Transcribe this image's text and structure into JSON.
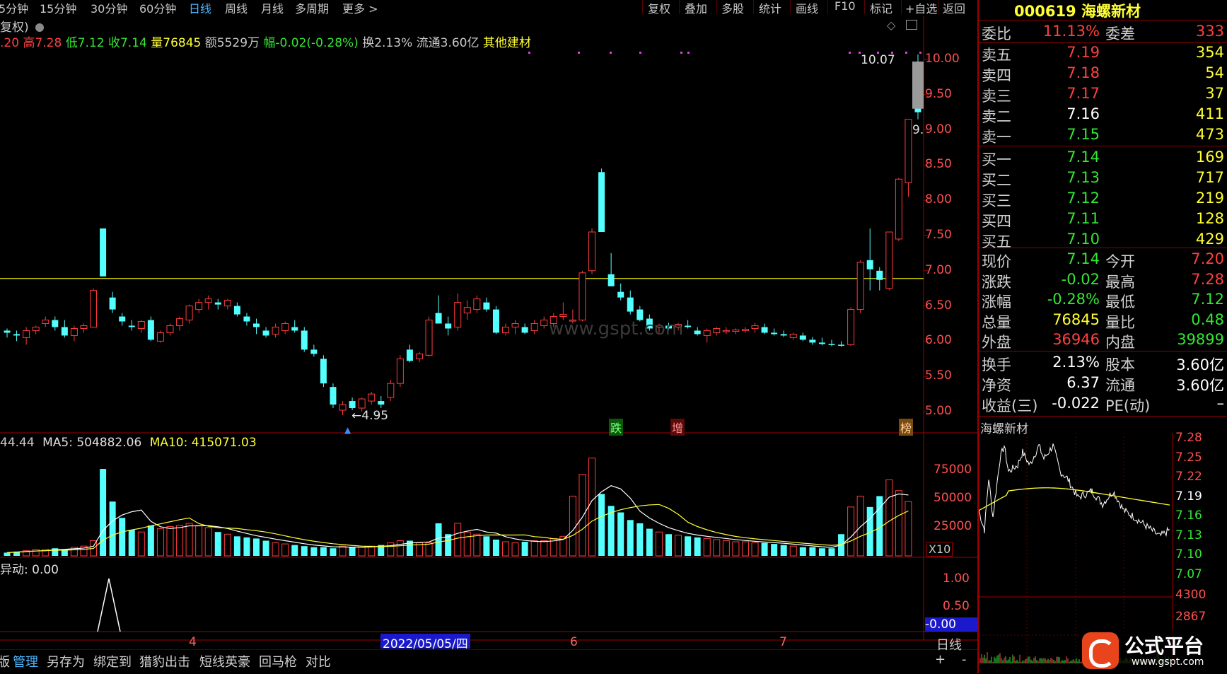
{
  "topbar": {
    "periods": [
      "5分钟",
      "15分钟",
      "30分钟",
      "60分钟",
      "日线",
      "周线",
      "月线",
      "多周期",
      "更多 >"
    ],
    "active_period": "日线",
    "buttons": [
      "复权",
      "叠加",
      "多股",
      "统计",
      "画线",
      "F10",
      "标记",
      "+自选",
      "返回"
    ]
  },
  "stock": {
    "code": "000619",
    "name": "海螺新材"
  },
  "info": {
    "fuquan": "复权)",
    "open": ".20",
    "high": "高7.28",
    "low": "低7.12",
    "close": "收7.14",
    "volume": "量76845",
    "amount": "额5529万",
    "change": "幅-0.02(-0.28%)",
    "turnover": "换2.13%",
    "float": "流通3.60亿",
    "sector": "其他建材"
  },
  "price_axis": [
    "10.00",
    "9.50",
    "9.00",
    "8.50",
    "8.00",
    "7.50",
    "7.00",
    "6.50",
    "6.00",
    "5.50",
    "5.00"
  ],
  "annotations": {
    "high_price": "10.07",
    "low_price": "4.95",
    "nine": "9.",
    "tag_die": "跌",
    "tag_zeng": "增",
    "tag_bang": "榜",
    "watermark": "www.gspt.com"
  },
  "volume_panel": {
    "legend_prefix": "44.44",
    "ma5": "MA5: 504882.06",
    "ma10": "MA10: 415071.03",
    "axis": [
      "75000",
      "50000",
      "25000"
    ],
    "unit": "X10"
  },
  "indicator_panel": {
    "label": "异动: 0.00",
    "axis": [
      "1.00",
      "0.50"
    ],
    "current": "-0.00"
  },
  "date_axis": {
    "labels": [
      "4",
      "6",
      "7"
    ],
    "cursor_date": "2022/05/05/四"
  },
  "bottom_bar": {
    "buttons": [
      "版",
      "管理",
      "另存为",
      "绑定到",
      "猎豹出击",
      "短线英豪",
      "回马枪",
      "对比"
    ],
    "active": "管理",
    "right_label": "日线",
    "plus": "+",
    "minus": "-"
  },
  "order_book": {
    "weibi_label": "委比",
    "weibi_value": "11.13%",
    "weicha_label": "委差",
    "weicha_value": "333",
    "asks": [
      {
        "label": "卖五",
        "price": "7.19",
        "volume": "354"
      },
      {
        "label": "卖四",
        "price": "7.18",
        "volume": "54"
      },
      {
        "label": "卖三",
        "price": "7.17",
        "volume": "37"
      },
      {
        "label": "卖二",
        "price": "7.16",
        "volume": "411"
      },
      {
        "label": "卖一",
        "price": "7.15",
        "volume": "473"
      }
    ],
    "bids": [
      {
        "label": "买一",
        "price": "7.14",
        "volume": "169"
      },
      {
        "label": "买二",
        "price": "7.13",
        "volume": "717"
      },
      {
        "label": "买三",
        "price": "7.12",
        "volume": "219"
      },
      {
        "label": "买四",
        "price": "7.11",
        "volume": "128"
      },
      {
        "label": "买五",
        "price": "7.10",
        "volume": "429"
      }
    ]
  },
  "quote": [
    {
      "l1": "现价",
      "v1": "7.14",
      "l2": "今开",
      "v2": "7.20"
    },
    {
      "l1": "涨跌",
      "v1": "-0.02",
      "l2": "最高",
      "v2": "7.28"
    },
    {
      "l1": "涨幅",
      "v1": "-0.28%",
      "l2": "最低",
      "v2": "7.12"
    },
    {
      "l1": "总量",
      "v1": "76845",
      "l2": "量比",
      "v2": "0.48"
    },
    {
      "l1": "外盘",
      "v1": "36946",
      "l2": "内盘",
      "v2": "39899"
    }
  ],
  "quote2": [
    {
      "l1": "换手",
      "v1": "2.13%",
      "l2": "股本",
      "v2": "3.60亿"
    },
    {
      "l1": "净资",
      "v1": "6.37",
      "l2": "流通",
      "v2": "3.60亿"
    },
    {
      "l1": "收益(三)",
      "v1": "-0.022",
      "l2": "PE(动)",
      "v2": "–"
    }
  ],
  "mini_chart": {
    "title": "海螺新材",
    "price_axis": [
      "7.28",
      "7.25",
      "7.22",
      "7.19",
      "7.16",
      "7.13",
      "7.10",
      "7.07"
    ],
    "vol_axis": [
      "4300",
      "2867"
    ]
  },
  "logo": {
    "text": "公式平台",
    "url": "www.gspt.com"
  },
  "chart_data": {
    "type": "candlestick",
    "price_ylim": [
      4.9,
      10.1
    ],
    "reference_line": 6.89,
    "candles": [
      {
        "o": 6.15,
        "h": 6.18,
        "l": 6.05,
        "c": 6.12
      },
      {
        "o": 6.1,
        "h": 6.15,
        "l": 6.0,
        "c": 6.08
      },
      {
        "o": 6.05,
        "h": 6.2,
        "l": 5.95,
        "c": 6.15
      },
      {
        "o": 6.15,
        "h": 6.22,
        "l": 6.1,
        "c": 6.2
      },
      {
        "o": 6.25,
        "h": 6.35,
        "l": 6.2,
        "c": 6.3
      },
      {
        "o": 6.3,
        "h": 6.35,
        "l": 6.15,
        "c": 6.2
      },
      {
        "o": 6.2,
        "h": 6.3,
        "l": 6.05,
        "c": 6.08
      },
      {
        "o": 6.08,
        "h": 6.22,
        "l": 6.0,
        "c": 6.18
      },
      {
        "o": 6.18,
        "h": 6.25,
        "l": 6.12,
        "c": 6.22
      },
      {
        "o": 6.2,
        "h": 6.75,
        "l": 6.2,
        "c": 6.72
      },
      {
        "o": 7.6,
        "h": 7.6,
        "l": 6.92,
        "c": 6.92
      },
      {
        "o": 6.62,
        "h": 6.7,
        "l": 6.4,
        "c": 6.45
      },
      {
        "o": 6.35,
        "h": 6.4,
        "l": 6.22,
        "c": 6.28
      },
      {
        "o": 6.22,
        "h": 6.3,
        "l": 6.15,
        "c": 6.2
      },
      {
        "o": 6.18,
        "h": 6.3,
        "l": 6.12,
        "c": 6.28
      },
      {
        "o": 6.3,
        "h": 6.35,
        "l": 6.0,
        "c": 6.02
      },
      {
        "o": 6.0,
        "h": 6.15,
        "l": 5.98,
        "c": 6.12
      },
      {
        "o": 6.12,
        "h": 6.25,
        "l": 6.08,
        "c": 6.22
      },
      {
        "o": 6.22,
        "h": 6.35,
        "l": 6.15,
        "c": 6.32
      },
      {
        "o": 6.3,
        "h": 6.52,
        "l": 6.25,
        "c": 6.5
      },
      {
        "o": 6.45,
        "h": 6.6,
        "l": 6.4,
        "c": 6.55
      },
      {
        "o": 6.55,
        "h": 6.65,
        "l": 6.45,
        "c": 6.6
      },
      {
        "o": 6.55,
        "h": 6.6,
        "l": 6.45,
        "c": 6.52
      },
      {
        "o": 6.5,
        "h": 6.6,
        "l": 6.45,
        "c": 6.58
      },
      {
        "o": 6.5,
        "h": 6.55,
        "l": 6.35,
        "c": 6.38
      },
      {
        "o": 6.35,
        "h": 6.4,
        "l": 6.22,
        "c": 6.28
      },
      {
        "o": 6.25,
        "h": 6.32,
        "l": 6.1,
        "c": 6.2
      },
      {
        "o": 6.15,
        "h": 6.2,
        "l": 6.05,
        "c": 6.08
      },
      {
        "o": 6.1,
        "h": 6.25,
        "l": 6.05,
        "c": 6.2
      },
      {
        "o": 6.15,
        "h": 6.28,
        "l": 6.1,
        "c": 6.25
      },
      {
        "o": 6.2,
        "h": 6.3,
        "l": 6.12,
        "c": 6.15
      },
      {
        "o": 6.15,
        "h": 6.2,
        "l": 5.85,
        "c": 5.88
      },
      {
        "o": 5.88,
        "h": 5.95,
        "l": 5.78,
        "c": 5.82
      },
      {
        "o": 5.75,
        "h": 5.8,
        "l": 5.35,
        "c": 5.4
      },
      {
        "o": 5.35,
        "h": 5.4,
        "l": 5.05,
        "c": 5.1
      },
      {
        "o": 5.02,
        "h": 5.15,
        "l": 4.95,
        "c": 5.1
      },
      {
        "o": 5.15,
        "h": 5.2,
        "l": 5.02,
        "c": 5.05
      },
      {
        "o": 5.05,
        "h": 5.2,
        "l": 5.0,
        "c": 5.18
      },
      {
        "o": 5.15,
        "h": 5.28,
        "l": 5.1,
        "c": 5.25
      },
      {
        "o": 5.15,
        "h": 5.22,
        "l": 5.05,
        "c": 5.1
      },
      {
        "o": 5.2,
        "h": 5.45,
        "l": 5.15,
        "c": 5.4
      },
      {
        "o": 5.4,
        "h": 5.8,
        "l": 5.35,
        "c": 5.75
      },
      {
        "o": 5.88,
        "h": 5.95,
        "l": 5.7,
        "c": 5.72
      },
      {
        "o": 5.75,
        "h": 5.85,
        "l": 5.7,
        "c": 5.82
      },
      {
        "o": 5.8,
        "h": 6.35,
        "l": 5.78,
        "c": 6.3
      },
      {
        "o": 6.4,
        "h": 6.65,
        "l": 6.25,
        "c": 6.25
      },
      {
        "o": 6.25,
        "h": 6.35,
        "l": 6.08,
        "c": 6.18
      },
      {
        "o": 6.2,
        "h": 6.68,
        "l": 6.15,
        "c": 6.55
      },
      {
        "o": 6.4,
        "h": 6.58,
        "l": 6.3,
        "c": 6.48
      },
      {
        "o": 6.45,
        "h": 6.65,
        "l": 6.4,
        "c": 6.6
      },
      {
        "o": 6.55,
        "h": 6.62,
        "l": 6.42,
        "c": 6.45
      },
      {
        "o": 6.45,
        "h": 6.5,
        "l": 6.1,
        "c": 6.12
      },
      {
        "o": 6.12,
        "h": 6.25,
        "l": 6.08,
        "c": 6.2
      },
      {
        "o": 6.2,
        "h": 6.3,
        "l": 6.1,
        "c": 6.25
      },
      {
        "o": 6.2,
        "h": 6.25,
        "l": 6.1,
        "c": 6.12
      },
      {
        "o": 6.15,
        "h": 6.3,
        "l": 6.1,
        "c": 6.25
      },
      {
        "o": 6.22,
        "h": 6.35,
        "l": 6.18,
        "c": 6.3
      },
      {
        "o": 6.25,
        "h": 6.4,
        "l": 6.2,
        "c": 6.35
      },
      {
        "o": 6.35,
        "h": 6.55,
        "l": 6.3,
        "c": 6.38
      },
      {
        "o": 6.3,
        "h": 6.45,
        "l": 6.25,
        "c": 6.3
      },
      {
        "o": 6.3,
        "h": 7.0,
        "l": 6.28,
        "c": 6.97
      },
      {
        "o": 7.0,
        "h": 7.6,
        "l": 6.95,
        "c": 7.55
      },
      {
        "o": 8.4,
        "h": 8.45,
        "l": 7.55,
        "c": 7.55
      },
      {
        "o": 6.95,
        "h": 7.25,
        "l": 6.78,
        "c": 6.78
      },
      {
        "o": 6.7,
        "h": 6.82,
        "l": 6.58,
        "c": 6.62
      },
      {
        "o": 6.62,
        "h": 6.72,
        "l": 6.38,
        "c": 6.42
      },
      {
        "o": 6.45,
        "h": 6.5,
        "l": 6.28,
        "c": 6.3
      },
      {
        "o": 6.32,
        "h": 6.38,
        "l": 6.15,
        "c": 6.18
      },
      {
        "o": 6.2,
        "h": 6.25,
        "l": 6.12,
        "c": 6.22
      },
      {
        "o": 6.22,
        "h": 6.26,
        "l": 6.16,
        "c": 6.18
      },
      {
        "o": 6.2,
        "h": 6.26,
        "l": 6.15,
        "c": 6.24
      },
      {
        "o": 6.22,
        "h": 6.3,
        "l": 6.18,
        "c": 6.2
      },
      {
        "o": 6.15,
        "h": 6.2,
        "l": 6.08,
        "c": 6.1
      },
      {
        "o": 6.08,
        "h": 6.18,
        "l": 5.98,
        "c": 6.15
      },
      {
        "o": 6.12,
        "h": 6.2,
        "l": 6.08,
        "c": 6.18
      },
      {
        "o": 6.15,
        "h": 6.2,
        "l": 6.1,
        "c": 6.15
      },
      {
        "o": 6.14,
        "h": 6.18,
        "l": 6.1,
        "c": 6.16
      },
      {
        "o": 6.15,
        "h": 6.2,
        "l": 6.12,
        "c": 6.17
      },
      {
        "o": 6.18,
        "h": 6.26,
        "l": 6.12,
        "c": 6.22
      },
      {
        "o": 6.2,
        "h": 6.25,
        "l": 6.1,
        "c": 6.12
      },
      {
        "o": 6.12,
        "h": 6.18,
        "l": 6.08,
        "c": 6.1
      },
      {
        "o": 6.1,
        "h": 6.15,
        "l": 6.06,
        "c": 6.08
      },
      {
        "o": 6.05,
        "h": 6.12,
        "l": 6.02,
        "c": 6.1
      },
      {
        "o": 6.08,
        "h": 6.12,
        "l": 6.0,
        "c": 6.02
      },
      {
        "o": 6.02,
        "h": 6.06,
        "l": 5.95,
        "c": 5.98
      },
      {
        "o": 5.98,
        "h": 6.05,
        "l": 5.94,
        "c": 5.96
      },
      {
        "o": 5.96,
        "h": 6.02,
        "l": 5.93,
        "c": 5.95
      },
      {
        "o": 5.95,
        "h": 6.0,
        "l": 5.92,
        "c": 5.94
      },
      {
        "o": 5.95,
        "h": 6.48,
        "l": 5.93,
        "c": 6.45
      },
      {
        "o": 6.45,
        "h": 7.15,
        "l": 6.4,
        "c": 7.12
      },
      {
        "o": 7.15,
        "h": 7.6,
        "l": 6.72,
        "c": 7.02
      },
      {
        "o": 7.0,
        "h": 7.05,
        "l": 6.72,
        "c": 6.87
      },
      {
        "o": 6.75,
        "h": 7.55,
        "l": 6.72,
        "c": 7.55
      },
      {
        "o": 7.45,
        "h": 8.32,
        "l": 7.42,
        "c": 8.3
      },
      {
        "o": 8.25,
        "h": 9.15,
        "l": 8.05,
        "c": 9.15
      },
      {
        "o": 9.95,
        "h": 10.07,
        "l": 9.15,
        "c": 9.25
      }
    ],
    "volumes": [
      3,
      4,
      5,
      6,
      6,
      7,
      6,
      8,
      9,
      14,
      80,
      50,
      35,
      24,
      22,
      28,
      25,
      27,
      28,
      30,
      28,
      26,
      22,
      20,
      18,
      17,
      16,
      14,
      12,
      11,
      10,
      9,
      8,
      8,
      7,
      9,
      8,
      8,
      9,
      10,
      12,
      14,
      14,
      12,
      12,
      30,
      20,
      30,
      22,
      20,
      18,
      15,
      13,
      12,
      13,
      14,
      14,
      16,
      18,
      55,
      75,
      90,
      57,
      46,
      40,
      33,
      30,
      25,
      22,
      20,
      19,
      18,
      17,
      16,
      15,
      14,
      13,
      13,
      12,
      12,
      11,
      10,
      9,
      8,
      8,
      7,
      7,
      20,
      45,
      55,
      45,
      55,
      70,
      60,
      50
    ],
    "volume_ylim": [
      0,
      95000
    ]
  }
}
